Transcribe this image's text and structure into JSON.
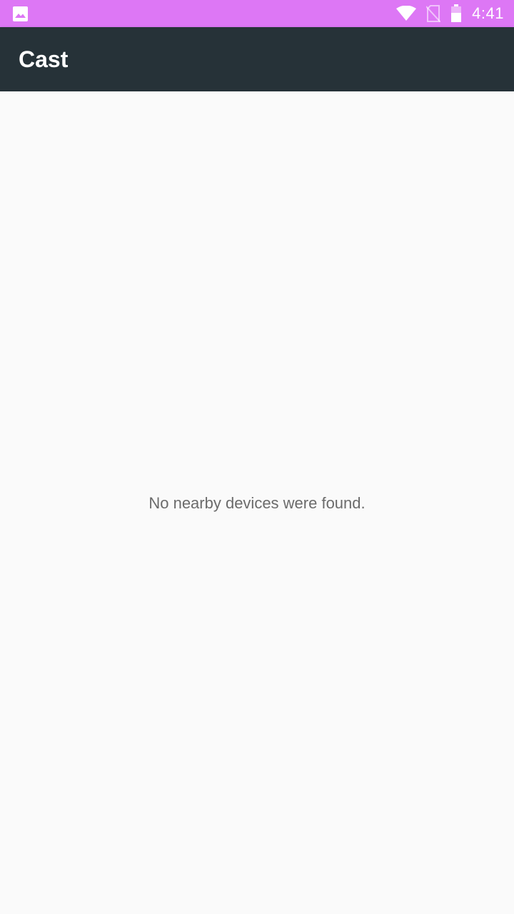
{
  "status_bar": {
    "time": "4:41",
    "notification_icon": "image-icon",
    "icons": [
      "wifi-icon",
      "no-sim-icon",
      "battery-icon"
    ],
    "background_color": "#dd77f5"
  },
  "toolbar": {
    "title": "Cast",
    "background_color": "#263238"
  },
  "content": {
    "empty_message": "No nearby devices were found."
  }
}
